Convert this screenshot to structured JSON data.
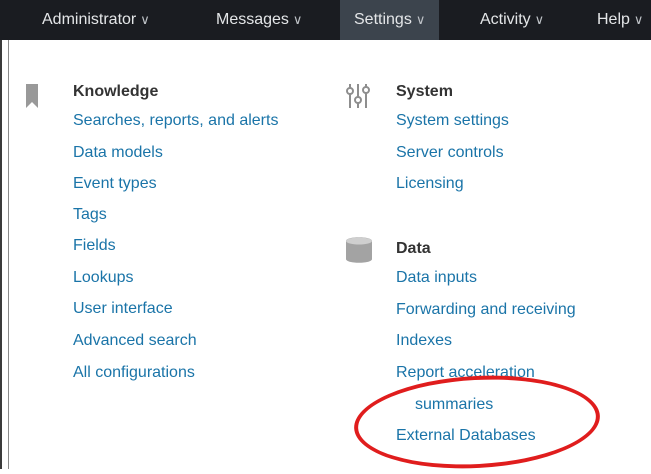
{
  "nav": {
    "items": [
      {
        "label": "Administrator",
        "chevron": "∨"
      },
      {
        "label": "Messages",
        "chevron": "∨"
      },
      {
        "label": "Settings",
        "chevron": "∨"
      },
      {
        "label": "Activity",
        "chevron": "∨"
      },
      {
        "label": "Help",
        "chevron": "∨"
      }
    ]
  },
  "knowledge": {
    "icon": "bookmark-icon",
    "heading": "Knowledge",
    "links": [
      "Searches, reports, and alerts",
      "Data models",
      "Event types",
      "Tags",
      "Fields",
      "Lookups",
      "User interface",
      "Advanced search",
      "All configurations"
    ]
  },
  "system": {
    "icon": "sliders-icon",
    "heading": "System",
    "links": [
      "System settings",
      "Server controls",
      "Licensing"
    ]
  },
  "data": {
    "icon": "database-icon",
    "heading": "Data",
    "links": [
      "Data inputs",
      "Forwarding and receiving",
      "Indexes",
      "Report acceleration",
      "summaries",
      "External Databases"
    ]
  },
  "colors": {
    "nav_bg": "#1a1c21",
    "nav_active": "#3c444d",
    "link": "#1a74a8",
    "highlight": "#e01d1d"
  }
}
